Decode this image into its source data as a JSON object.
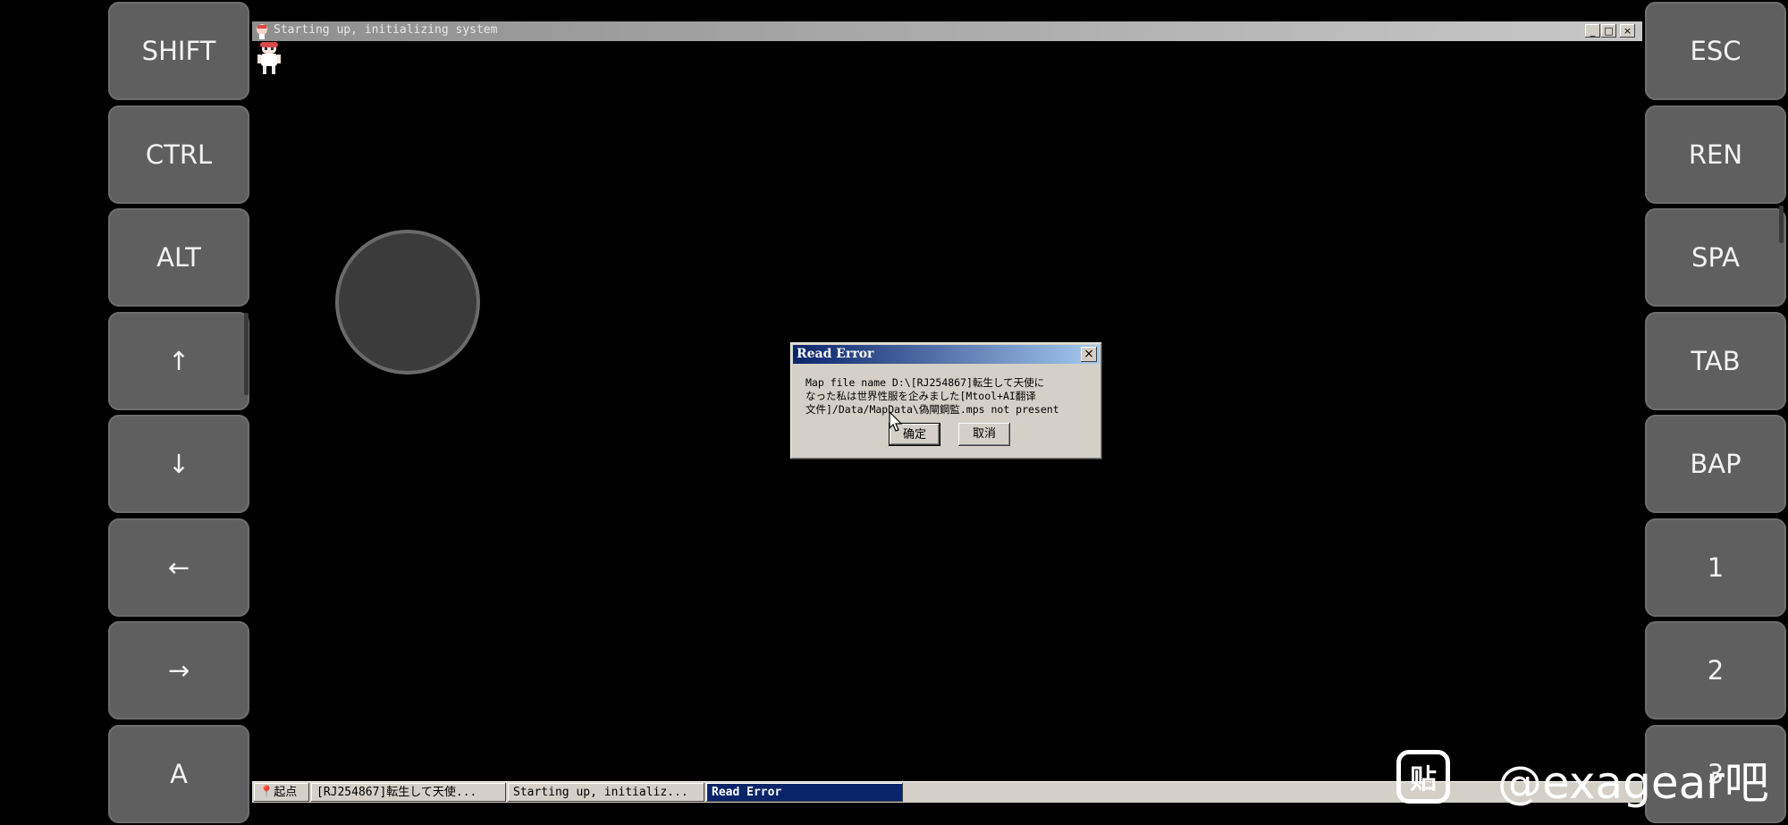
{
  "left_keys": [
    {
      "label": "SHIFT"
    },
    {
      "label": "CTRL"
    },
    {
      "label": "ALT"
    },
    {
      "label": "↑"
    },
    {
      "label": "↓"
    },
    {
      "label": "←"
    },
    {
      "label": "→"
    },
    {
      "label": "A"
    }
  ],
  "right_keys": [
    {
      "label": "ESC"
    },
    {
      "label": "REN"
    },
    {
      "label": "SPA"
    },
    {
      "label": "TAB"
    },
    {
      "label": "BAP"
    },
    {
      "label": "1"
    },
    {
      "label": "2"
    },
    {
      "label": "3"
    }
  ],
  "window": {
    "title": "Starting up, initializing system",
    "controls": {
      "minimize": "_",
      "maximize": "□",
      "close": "×"
    }
  },
  "dialog": {
    "title": "Read Error",
    "close": "×",
    "message_lines": [
      "Map file name D:\\[RJ254867]転生して天使に",
      "なった私は世界性服を企みました[Mtool+AI翻译",
      "文件]/Data/MapData\\偽閘鋼監.mps not present"
    ],
    "ok_label": "确定",
    "cancel_label": "取消"
  },
  "taskbar": {
    "start_label": "起点",
    "tasks": [
      {
        "label": "[RJ254867]転生して天使..."
      },
      {
        "label": "Starting up, initializ..."
      },
      {
        "label": "Read Error"
      }
    ]
  },
  "watermark": {
    "logo_glyph": "贴",
    "text": "@exagear吧"
  },
  "colors": {
    "key_bg": "#5f5f5f",
    "title_active": "#0a246a",
    "window_face": "#d4d0c8"
  }
}
